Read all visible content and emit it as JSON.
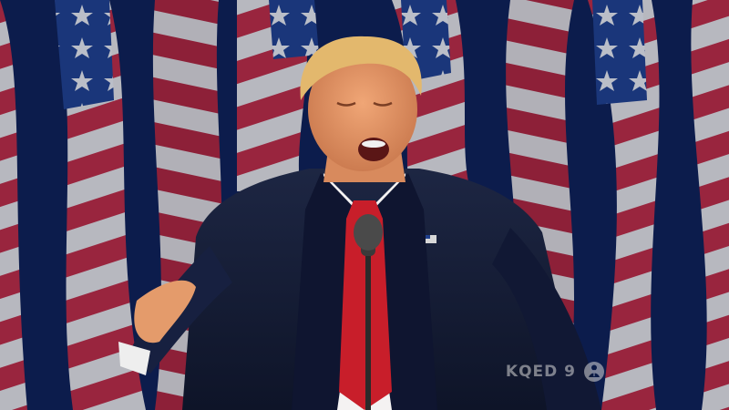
{
  "broadcast": {
    "watermark_text": "KQED 9",
    "logo_icon": "pbs-logo-icon"
  },
  "colors": {
    "flag_red": "#c8283c",
    "flag_white": "#f1ece9",
    "flag_blue": "#1f3f8c",
    "suit": "#141b33",
    "shirt": "#f4f2f2",
    "tie": "#c81e2a",
    "skin": "#e39a6a",
    "hair": "#e3b86d"
  }
}
